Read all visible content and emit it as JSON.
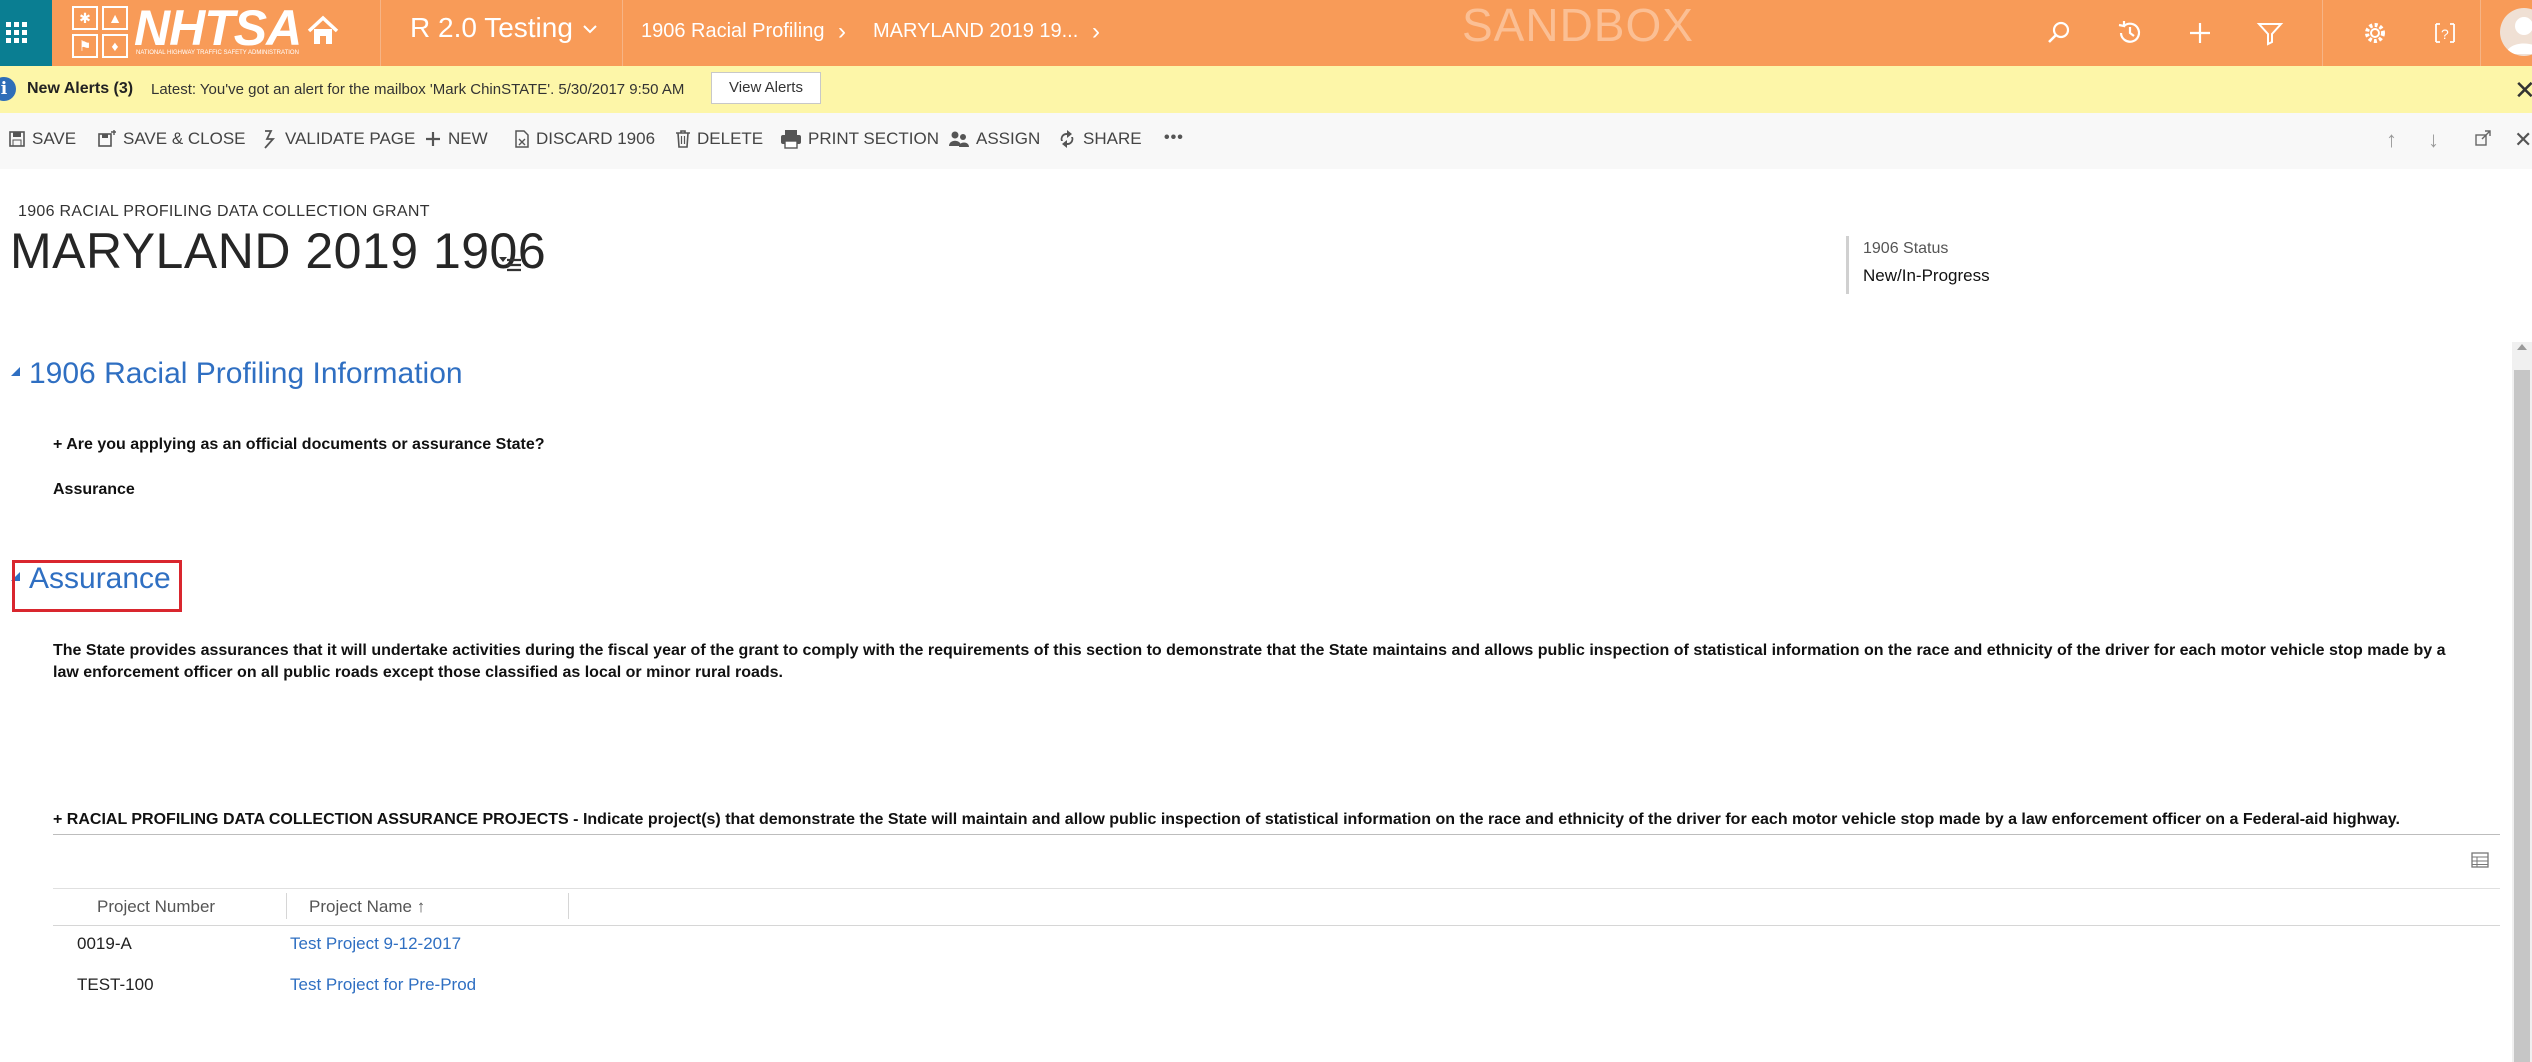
{
  "topbar": {
    "logo_text": "NHTSA",
    "logo_subtext": "NATIONAL HIGHWAY TRAFFIC SAFETY ADMINISTRATION",
    "app_title": "R 2.0 Testing",
    "breadcrumb_entity": "1906 Racial Profiling",
    "breadcrumb_record": "MARYLAND 2019 19...",
    "watermark": "SANDBOX",
    "colors": {
      "bar": "#f89b58",
      "apps_button": "#0a7e92"
    }
  },
  "alert": {
    "title": "New Alerts (3)",
    "message": "Latest: You've got an alert for the mailbox 'Mark ChinSTATE'. 5/30/2017 9:50 AM",
    "button_label": "View Alerts"
  },
  "commands": {
    "save": "SAVE",
    "save_close": "SAVE & CLOSE",
    "validate": "VALIDATE PAGE",
    "new": "NEW",
    "discard": "DISCARD 1906",
    "delete": "DELETE",
    "print": "PRINT SECTION",
    "assign": "ASSIGN",
    "share": "SHARE",
    "more": "•••"
  },
  "form": {
    "entity_label": "1906 RACIAL PROFILING DATA COLLECTION GRANT",
    "record_title": "MARYLAND 2019 1906",
    "status_label": "1906 Status",
    "status_value": "New/In-Progress"
  },
  "section1": {
    "title": "1906 Racial Profiling Information",
    "question": "+ Are you applying as an official documents or assurance State?",
    "answer": "Assurance"
  },
  "section2": {
    "title": "Assurance",
    "text": "The State provides assurances that it will undertake activities during the fiscal year of the grant to comply with the requirements of this section to demonstrate that the State maintains and allows public inspection of statistical information on the race and ethnicity of the driver for each motor vehicle stop made by a law enforcement officer on all public roads except those classified as local or minor rural roads.",
    "subgrid_label": "+ RACIAL PROFILING DATA COLLECTION ASSURANCE PROJECTS - Indicate project(s) that demonstrate the State will maintain and allow public inspection of statistical information on the race and ethnicity of the driver for each motor vehicle stop made by a law enforcement officer on a Federal-aid highway."
  },
  "projects": {
    "columns": [
      "Project Number",
      "Project Name ↑"
    ],
    "rows": [
      {
        "number": "0019-A",
        "name": "Test Project 9-12-2017"
      },
      {
        "number": "TEST-100",
        "name": "Test Project for Pre-Prod"
      }
    ]
  }
}
